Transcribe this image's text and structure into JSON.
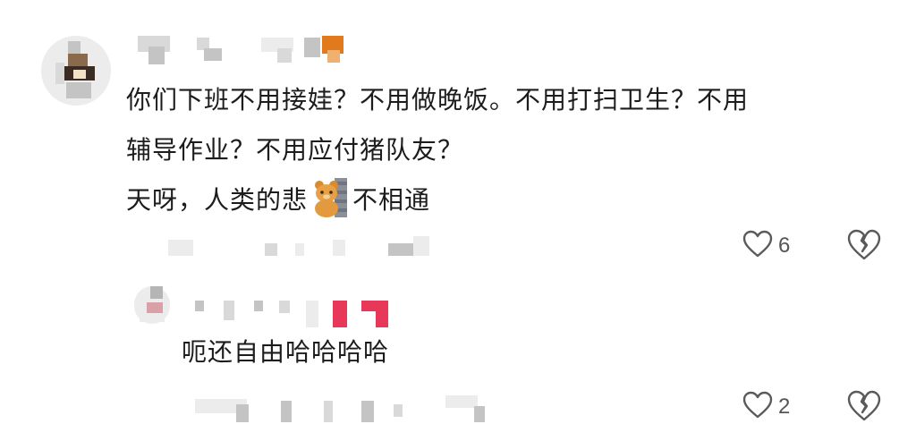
{
  "comment": {
    "lines": [
      "你们下班不用接娃？不用做晚饭。不用打扫卫生？不用",
      "辅导作业？不用应付猪队友？",
      "天呀，人类的悲",
      "不相通"
    ],
    "emoji_icon": "bear-emoji-icon",
    "likes": "6"
  },
  "reply": {
    "text": "呃还自由哈哈哈哈",
    "likes": "2"
  },
  "icons": {
    "like": "heart-outline-icon",
    "dislike": "broken-heart-icon"
  },
  "colors": {
    "text": "#1c1c1c",
    "icon": "#555555",
    "accent_orange": "#e07a1c",
    "accent_pink": "#e8385a"
  }
}
